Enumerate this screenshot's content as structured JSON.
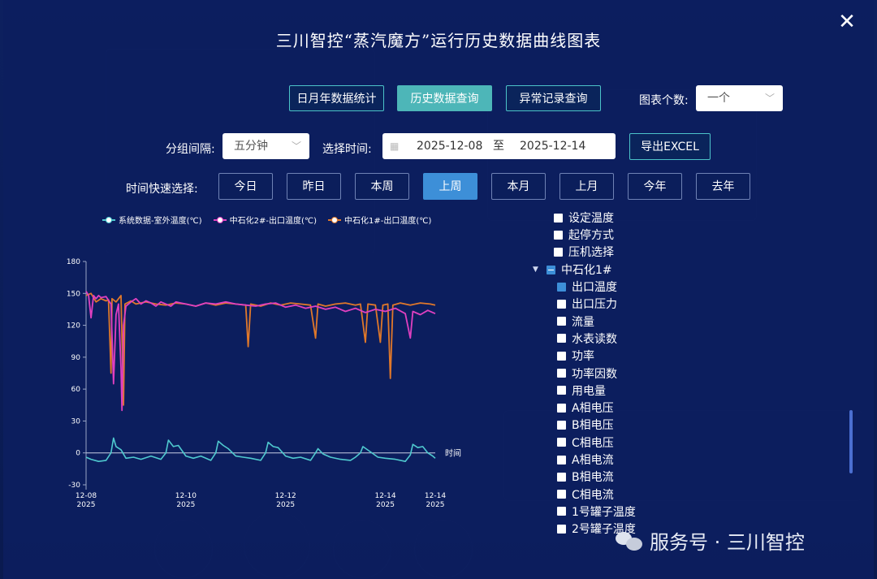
{
  "title": "三川智控“蒸汽魔方”运行历史数据曲线图表",
  "tabs": [
    {
      "label": "日月年数据统计",
      "active": false
    },
    {
      "label": "历史数据查询",
      "active": true
    },
    {
      "label": "异常记录查询",
      "active": false
    }
  ],
  "chart_count": {
    "label": "图表个数:",
    "value": "一个"
  },
  "group": {
    "label": "分组间隔:",
    "value": "五分钟"
  },
  "time": {
    "label": "选择时间:",
    "start": "2025-12-08",
    "sep": "至",
    "end": "2025-12-14"
  },
  "export_label": "导出EXCEL",
  "quick": {
    "label": "时间快速选择:",
    "buttons": [
      {
        "label": "今日",
        "active": false
      },
      {
        "label": "昨日",
        "active": false
      },
      {
        "label": "本周",
        "active": false
      },
      {
        "label": "上周",
        "active": true
      },
      {
        "label": "本月",
        "active": false
      },
      {
        "label": "上月",
        "active": false
      },
      {
        "label": "今年",
        "active": false
      },
      {
        "label": "去年",
        "active": false
      }
    ]
  },
  "tree": {
    "group_label": "中石化1#",
    "items_before": [
      {
        "label": "设定温度",
        "checked": false
      },
      {
        "label": "起停方式",
        "checked": false
      },
      {
        "label": "压机选择",
        "checked": false
      }
    ],
    "items_after": [
      {
        "label": "出口温度",
        "checked": true
      },
      {
        "label": "出口压力",
        "checked": false
      },
      {
        "label": "流量",
        "checked": false
      },
      {
        "label": "水表读数",
        "checked": false
      },
      {
        "label": "功率",
        "checked": false
      },
      {
        "label": "功率因数",
        "checked": false
      },
      {
        "label": "用电量",
        "checked": false
      },
      {
        "label": "A相电压",
        "checked": false
      },
      {
        "label": "B相电压",
        "checked": false
      },
      {
        "label": "C相电压",
        "checked": false
      },
      {
        "label": "A相电流",
        "checked": false
      },
      {
        "label": "B相电流",
        "checked": false
      },
      {
        "label": "C相电流",
        "checked": false
      },
      {
        "label": "1号罐子温度",
        "checked": false
      },
      {
        "label": "2号罐子温度",
        "checked": false
      }
    ]
  },
  "watermark": "服务号 · 三川智控",
  "chart_data": {
    "type": "line",
    "xlabel": "时间",
    "ylim": [
      -30,
      180
    ],
    "yticks": [
      180,
      150,
      120,
      90,
      60,
      30,
      0,
      -30
    ],
    "xticks": [
      {
        "t": 0.0,
        "date": "12-08",
        "year": "2025"
      },
      {
        "t": 2.0,
        "date": "12-10",
        "year": "2025"
      },
      {
        "t": 4.0,
        "date": "12-12",
        "year": "2025"
      },
      {
        "t": 6.0,
        "date": "12-14",
        "year": "2025"
      },
      {
        "t": 7.0,
        "date": "12-14",
        "year": "2025"
      }
    ],
    "series": [
      {
        "name": "系统数据-室外温度(℃)",
        "color": "#4fc9cf",
        "points": [
          [
            0,
            -4
          ],
          [
            0.1,
            -6
          ],
          [
            0.25,
            -8
          ],
          [
            0.4,
            -7
          ],
          [
            0.5,
            0
          ],
          [
            0.55,
            14
          ],
          [
            0.6,
            6
          ],
          [
            0.7,
            3
          ],
          [
            0.8,
            -5
          ],
          [
            0.95,
            -4
          ],
          [
            1.1,
            -6
          ],
          [
            1.3,
            -3
          ],
          [
            1.5,
            -6
          ],
          [
            1.6,
            0
          ],
          [
            1.65,
            12
          ],
          [
            1.75,
            6
          ],
          [
            1.85,
            7
          ],
          [
            2.0,
            -3
          ],
          [
            2.15,
            -5
          ],
          [
            2.3,
            -3
          ],
          [
            2.5,
            -7
          ],
          [
            2.6,
            0
          ],
          [
            2.65,
            11
          ],
          [
            2.75,
            7
          ],
          [
            2.85,
            4
          ],
          [
            3.0,
            -3
          ],
          [
            3.15,
            -4
          ],
          [
            3.3,
            -5
          ],
          [
            3.5,
            -7
          ],
          [
            3.6,
            0
          ],
          [
            3.65,
            10
          ],
          [
            3.75,
            6
          ],
          [
            3.85,
            5
          ],
          [
            4.0,
            -3
          ],
          [
            4.15,
            -5
          ],
          [
            4.3,
            -4
          ],
          [
            4.5,
            -7
          ],
          [
            4.6,
            0
          ],
          [
            4.65,
            4
          ],
          [
            4.75,
            -1
          ],
          [
            4.9,
            -4
          ],
          [
            5.1,
            -6
          ],
          [
            5.3,
            -7
          ],
          [
            5.4,
            -4
          ],
          [
            5.5,
            0
          ],
          [
            5.55,
            6
          ],
          [
            5.7,
            1
          ],
          [
            5.85,
            -4
          ],
          [
            6.0,
            -5
          ],
          [
            6.2,
            -6
          ],
          [
            6.4,
            -8
          ],
          [
            6.5,
            -2
          ],
          [
            6.55,
            8
          ],
          [
            6.65,
            5
          ],
          [
            6.75,
            6
          ],
          [
            6.85,
            0
          ],
          [
            6.95,
            -3
          ],
          [
            7.0,
            -5
          ]
        ]
      },
      {
        "name": "中石化2#-出口温度(℃)",
        "color": "#e040c0",
        "points": [
          [
            0,
            152
          ],
          [
            0.05,
            148
          ],
          [
            0.1,
            127
          ],
          [
            0.15,
            148
          ],
          [
            0.2,
            145
          ],
          [
            0.25,
            148
          ],
          [
            0.3,
            146
          ],
          [
            0.4,
            147
          ],
          [
            0.5,
            140
          ],
          [
            0.55,
            65
          ],
          [
            0.6,
            130
          ],
          [
            0.65,
            140
          ],
          [
            0.7,
            80
          ],
          [
            0.72,
            40
          ],
          [
            0.75,
            120
          ],
          [
            0.8,
            138
          ],
          [
            0.9,
            142
          ],
          [
            1.0,
            145
          ],
          [
            1.1,
            140
          ],
          [
            1.2,
            143
          ],
          [
            1.3,
            141
          ],
          [
            1.4,
            138
          ],
          [
            1.5,
            142
          ],
          [
            1.6,
            140
          ],
          [
            1.7,
            138
          ],
          [
            1.8,
            142
          ],
          [
            1.9,
            141
          ],
          [
            2.0,
            140
          ],
          [
            2.2,
            138
          ],
          [
            2.4,
            141
          ],
          [
            2.6,
            140
          ],
          [
            2.8,
            142
          ],
          [
            3.0,
            140
          ],
          [
            3.2,
            139
          ],
          [
            3.4,
            138
          ],
          [
            3.6,
            140
          ],
          [
            3.8,
            141
          ],
          [
            4.0,
            137
          ],
          [
            4.2,
            139
          ],
          [
            4.4,
            136
          ],
          [
            4.6,
            138
          ],
          [
            4.8,
            135
          ],
          [
            5.0,
            137
          ],
          [
            5.2,
            133
          ],
          [
            5.4,
            136
          ],
          [
            5.6,
            132
          ],
          [
            5.8,
            135
          ],
          [
            6.0,
            133
          ],
          [
            6.2,
            136
          ],
          [
            6.4,
            131
          ],
          [
            6.5,
            108
          ],
          [
            6.55,
            133
          ],
          [
            6.7,
            130
          ],
          [
            6.85,
            134
          ],
          [
            7.0,
            131
          ]
        ]
      },
      {
        "name": "中石化1#-出口温度(℃)",
        "color": "#e0782a",
        "points": [
          [
            0,
            148
          ],
          [
            0.1,
            150
          ],
          [
            0.2,
            142
          ],
          [
            0.3,
            145
          ],
          [
            0.4,
            143
          ],
          [
            0.45,
            144
          ],
          [
            0.5,
            75
          ],
          [
            0.52,
            145
          ],
          [
            0.6,
            142
          ],
          [
            0.7,
            148
          ],
          [
            0.75,
            45
          ],
          [
            0.78,
            140
          ],
          [
            0.9,
            143
          ],
          [
            1.0,
            140
          ],
          [
            1.2,
            142
          ],
          [
            1.4,
            140
          ],
          [
            1.6,
            139
          ],
          [
            1.8,
            141
          ],
          [
            2.0,
            140
          ],
          [
            2.2,
            138
          ],
          [
            2.4,
            141
          ],
          [
            2.6,
            139
          ],
          [
            2.8,
            141
          ],
          [
            3.0,
            140
          ],
          [
            3.2,
            139
          ],
          [
            3.25,
            100
          ],
          [
            3.3,
            140
          ],
          [
            3.5,
            138
          ],
          [
            3.7,
            141
          ],
          [
            3.9,
            139
          ],
          [
            4.1,
            141
          ],
          [
            4.3,
            140
          ],
          [
            4.5,
            139
          ],
          [
            4.6,
            108
          ],
          [
            4.65,
            140
          ],
          [
            4.8,
            138
          ],
          [
            5.0,
            140
          ],
          [
            5.2,
            141
          ],
          [
            5.4,
            139
          ],
          [
            5.5,
            140
          ],
          [
            5.6,
            104
          ],
          [
            5.65,
            140
          ],
          [
            5.8,
            139
          ],
          [
            5.9,
            104
          ],
          [
            5.95,
            139
          ],
          [
            6.05,
            140
          ],
          [
            6.1,
            70
          ],
          [
            6.15,
            139
          ],
          [
            6.3,
            141
          ],
          [
            6.5,
            139
          ],
          [
            6.7,
            141
          ],
          [
            6.9,
            140
          ],
          [
            7.0,
            139
          ]
        ]
      }
    ]
  }
}
